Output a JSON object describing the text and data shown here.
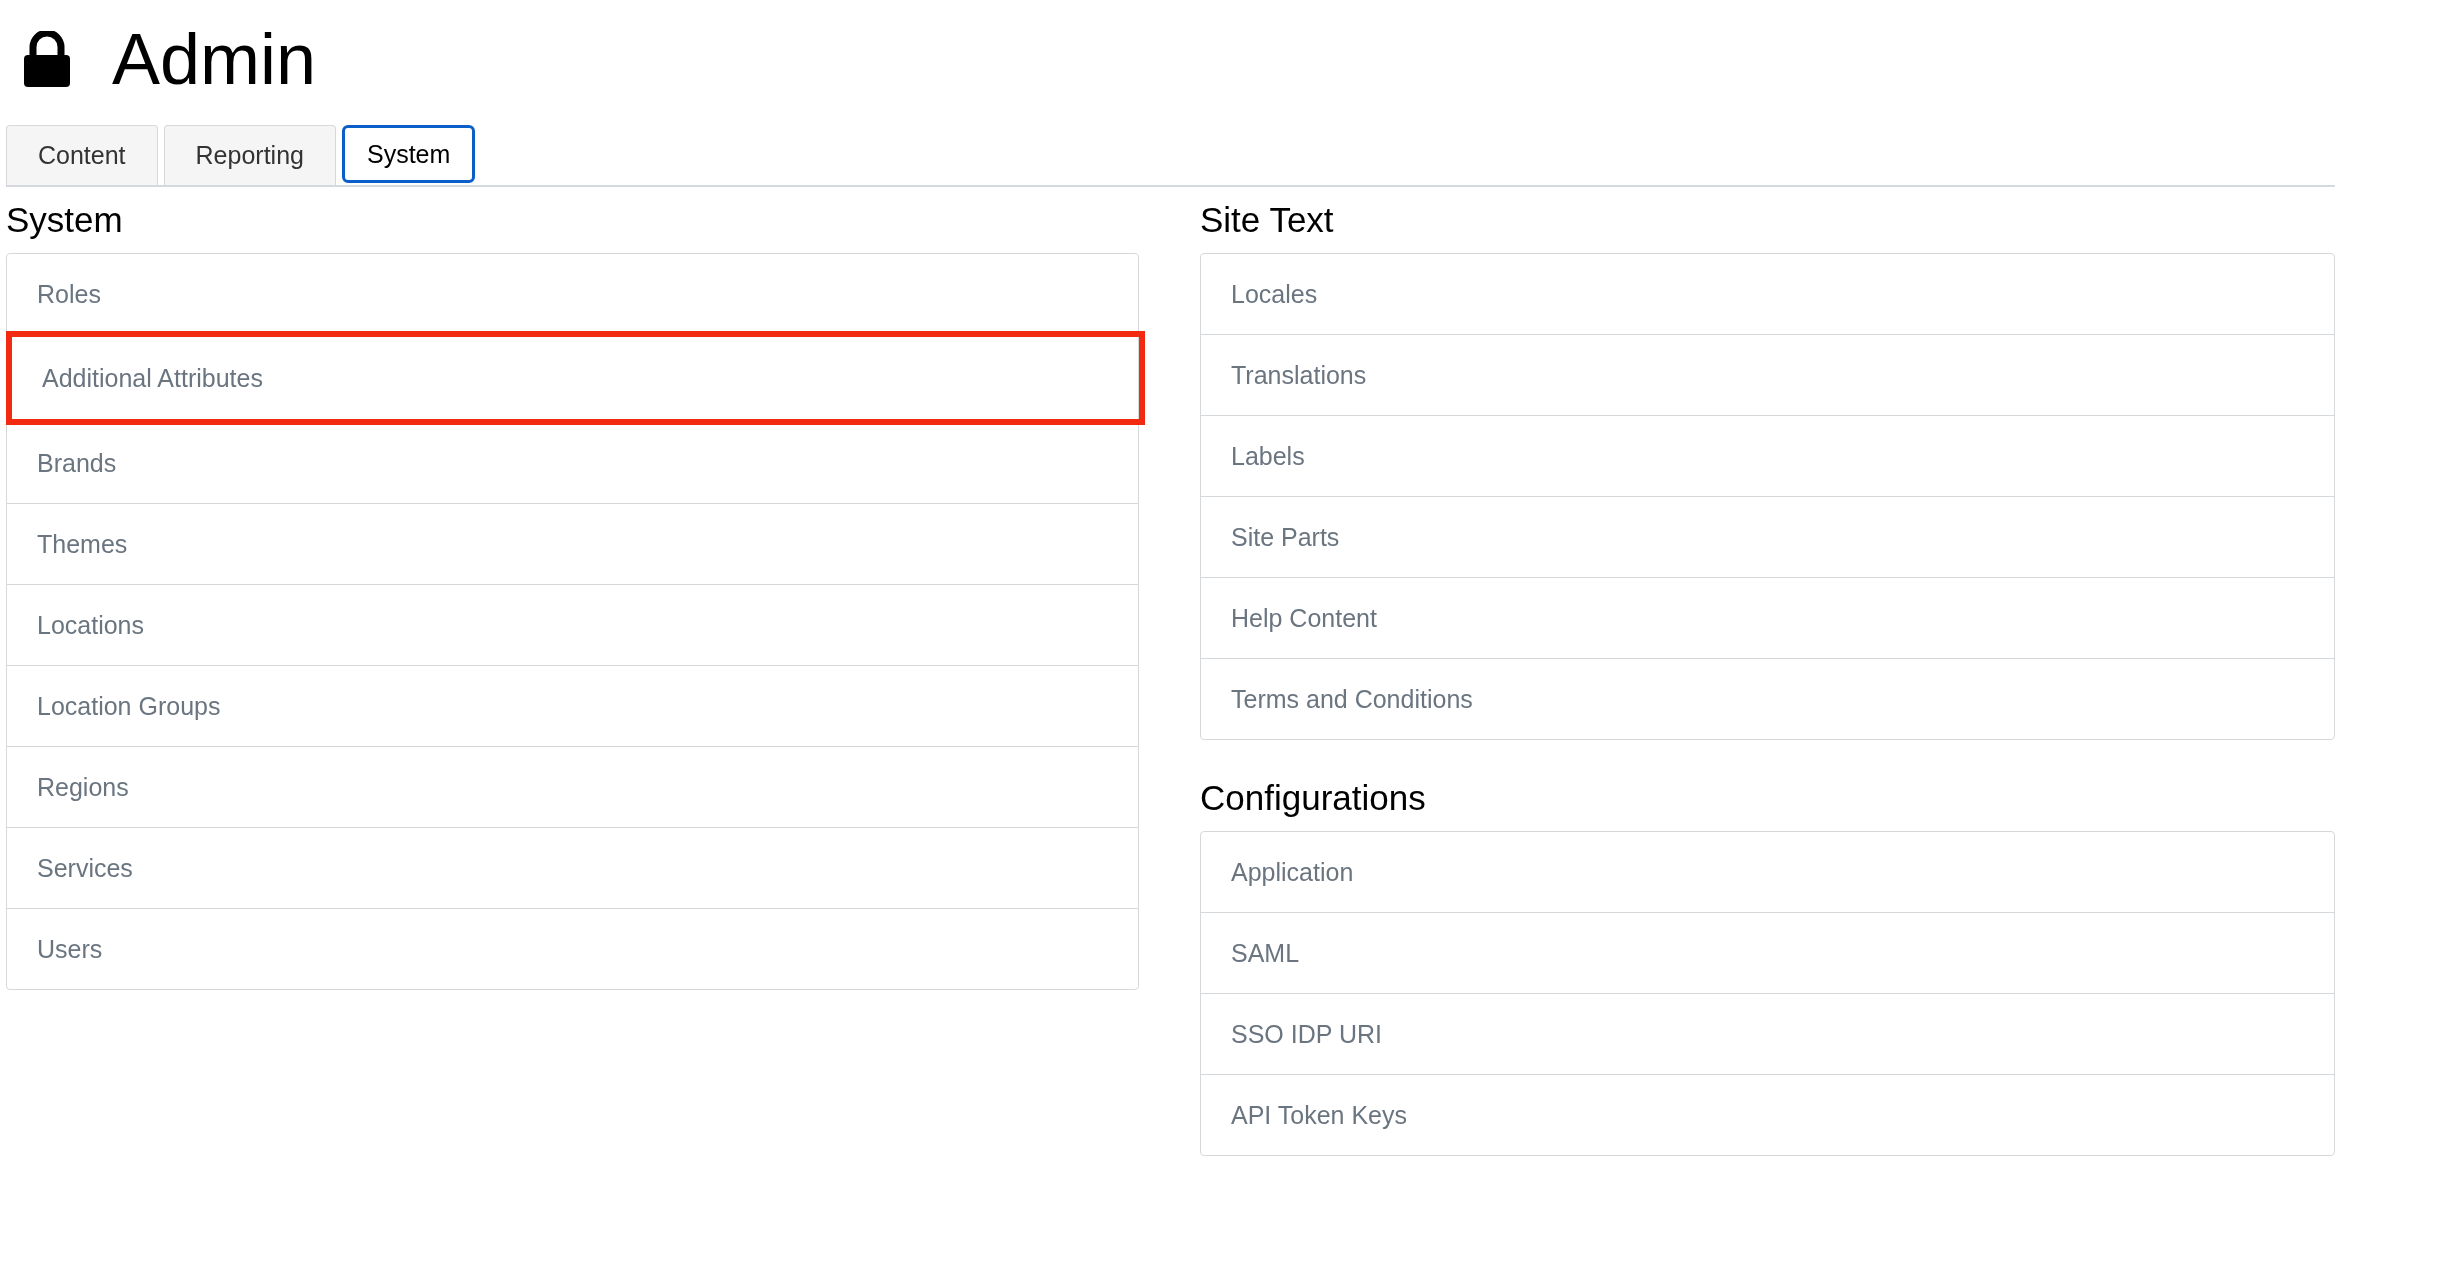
{
  "page": {
    "title": "Admin"
  },
  "tabs": [
    {
      "label": "Content",
      "selected": false
    },
    {
      "label": "Reporting",
      "selected": false
    },
    {
      "label": "System",
      "selected": true
    }
  ],
  "columns": [
    {
      "sections": [
        {
          "heading": "System",
          "items": [
            {
              "label": "Roles",
              "highlighted": false
            },
            {
              "label": "Additional Attributes",
              "highlighted": true
            },
            {
              "label": "Brands",
              "highlighted": false
            },
            {
              "label": "Themes",
              "highlighted": false
            },
            {
              "label": "Locations",
              "highlighted": false
            },
            {
              "label": "Location Groups",
              "highlighted": false
            },
            {
              "label": "Regions",
              "highlighted": false
            },
            {
              "label": "Services",
              "highlighted": false
            },
            {
              "label": "Users",
              "highlighted": false
            }
          ]
        }
      ]
    },
    {
      "sections": [
        {
          "heading": "Site Text",
          "items": [
            {
              "label": "Locales",
              "highlighted": false
            },
            {
              "label": "Translations",
              "highlighted": false
            },
            {
              "label": "Labels",
              "highlighted": false
            },
            {
              "label": "Site Parts",
              "highlighted": false
            },
            {
              "label": "Help Content",
              "highlighted": false
            },
            {
              "label": "Terms and Conditions",
              "highlighted": false
            }
          ]
        },
        {
          "heading": "Configurations",
          "items": [
            {
              "label": "Application",
              "highlighted": false
            },
            {
              "label": "SAML",
              "highlighted": false
            },
            {
              "label": "SSO IDP URI",
              "highlighted": false
            },
            {
              "label": "API Token Keys",
              "highlighted": false
            }
          ]
        }
      ]
    }
  ]
}
